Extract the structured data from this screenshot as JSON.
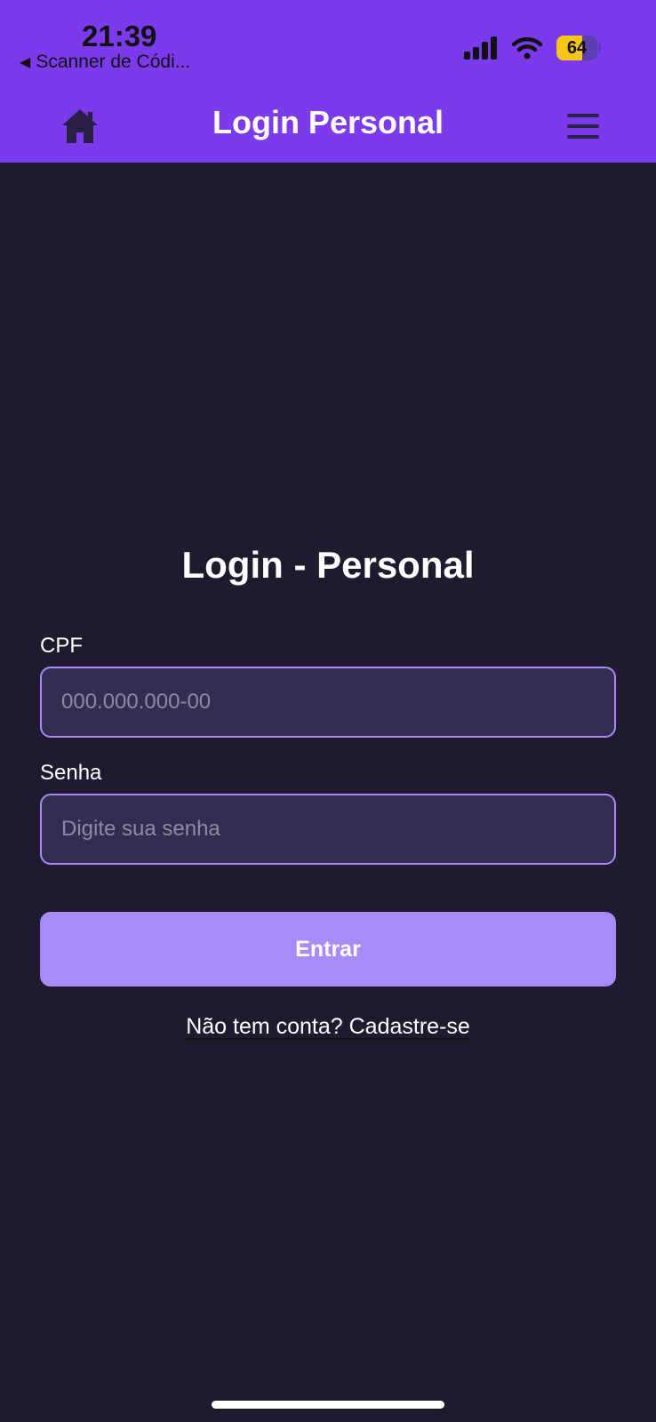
{
  "status_bar": {
    "time": "21:39",
    "back_app": "Scanner de Códi...",
    "battery_level": "64",
    "battery_fraction": 0.64
  },
  "nav": {
    "title": "Login Personal",
    "home_icon": "home-icon",
    "menu_icon": "hamburger-menu-icon"
  },
  "form": {
    "title": "Login - Personal",
    "cpf_label": "CPF",
    "cpf_placeholder": "000.000.000-00",
    "cpf_value": "",
    "password_label": "Senha",
    "password_placeholder": "Digite sua senha",
    "password_value": "",
    "submit_label": "Entrar",
    "signup_text": "Não tem conta? Cadastre-se"
  },
  "colors": {
    "header": "#7c3aed",
    "background": "#1e1b2e",
    "input_bg": "#352c52",
    "input_border": "#a78bfa",
    "button": "#a78bfa"
  }
}
